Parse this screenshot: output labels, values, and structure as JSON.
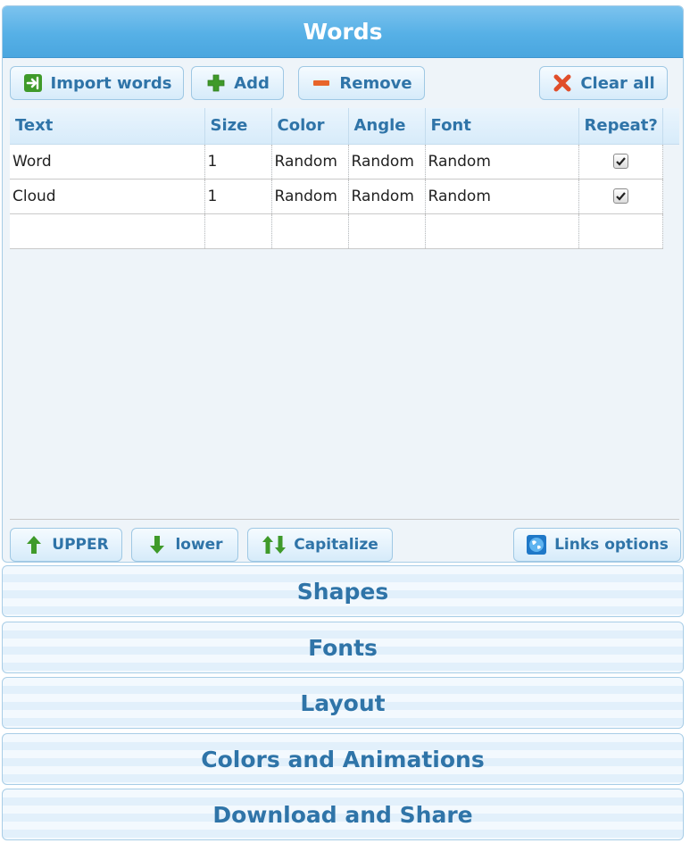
{
  "header": {
    "title": "Words"
  },
  "toolbar": {
    "import_label": "Import words",
    "add_label": "Add",
    "remove_label": "Remove",
    "clear_label": "Clear all"
  },
  "table": {
    "columns": [
      "Text",
      "Size",
      "Color",
      "Angle",
      "Font",
      "Repeat?"
    ],
    "rows": [
      {
        "text": "Word",
        "size": "1",
        "color": "Random",
        "angle": "Random",
        "font": "Random",
        "repeat": true
      },
      {
        "text": "Cloud",
        "size": "1",
        "color": "Random",
        "angle": "Random",
        "font": "Random",
        "repeat": true
      }
    ]
  },
  "case_tools": {
    "upper_label": "UPPER",
    "lower_label": "lower",
    "capitalize_label": "Capitalize",
    "links_label": "Links options"
  },
  "sections": [
    "Shapes",
    "Fonts",
    "Layout",
    "Colors and Animations",
    "Download and Share"
  ],
  "colors": {
    "header_blue": "#56b0e6",
    "label_blue": "#2f74a8",
    "add_green": "#3f9a2a",
    "remove_orange": "#e8642a",
    "clear_red": "#e04e2a"
  }
}
